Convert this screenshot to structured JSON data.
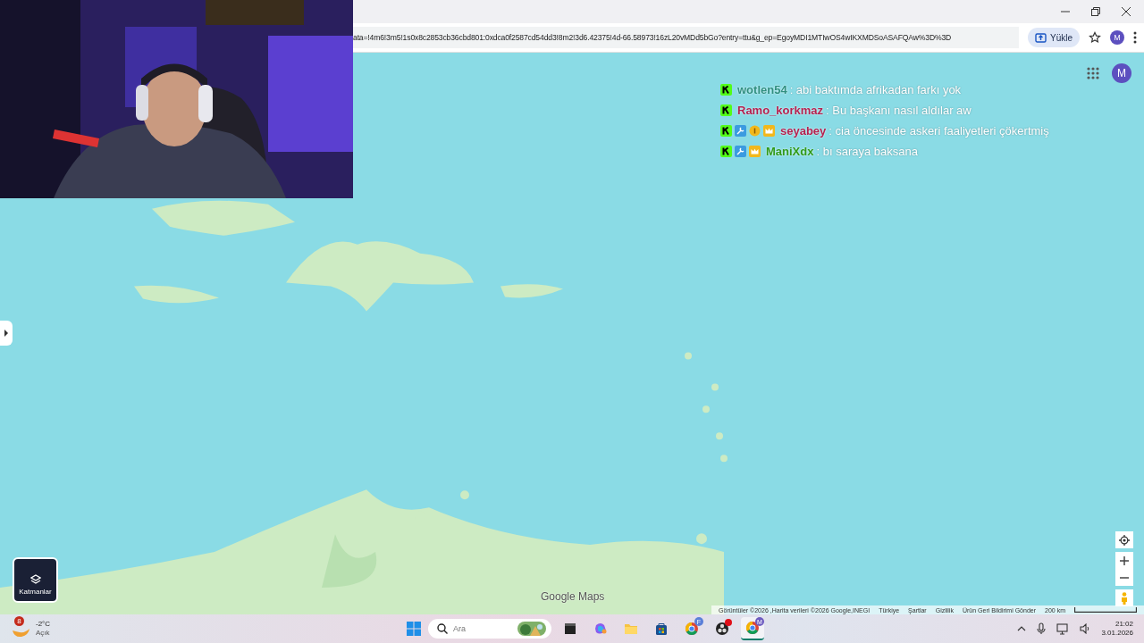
{
  "browser": {
    "address": "ata=!4m6!3m5!1s0x8c2853cb36cbd801:0xdca0f2587cd54dd3!8m2!3d6.42375!4d-66.58973!16zL20vMDd5bGo?entry=ttu&g_ep=EgoyMDI1MTIwOS4wIKXMDSoASAFQAw%3D%3D",
    "upload_button": "Yükle",
    "profile": "M"
  },
  "map": {
    "kind": "picture",
    "account": "M",
    "layers_button": "Katmanlar",
    "logo": "Google Maps",
    "footer": [
      "Görüntüler ©2026 ,Harita verileri ©2026 Google,INEGI",
      "Türkiye",
      "Şartlar",
      "Gizlilik",
      "Ürün Geri Bildirimi Gönder"
    ],
    "scale": "200 km"
  },
  "chat": [
    {
      "user": "wotlen54",
      "color": "#2f8f80",
      "badges": [
        {
          "kind": "kick"
        }
      ],
      "message": ": abi baktımda afrikadan farkı yok"
    },
    {
      "user": "Ramo_korkmaz",
      "color": "#b3214f",
      "badges": [
        {
          "kind": "kick"
        }
      ],
      "message": ": Bu başkanı nasıl aldılar aw"
    },
    {
      "user": "seyabey",
      "color": "#b3214f",
      "badges": [
        {
          "kind": "kick"
        },
        {
          "kind": "wrench"
        },
        {
          "kind": "coin"
        },
        {
          "kind": "crown"
        }
      ],
      "message": ": cia öncesinde askeri faaliyetleri çökertmiş"
    },
    {
      "user": "ManiXdx",
      "color": "#2f9a1a",
      "badges": [
        {
          "kind": "kick"
        },
        {
          "kind": "wrench"
        },
        {
          "kind": "crown"
        }
      ],
      "message": ": bı saraya baksana"
    }
  ],
  "taskbar": {
    "weather": {
      "badge": "8",
      "temperature": "-2°C",
      "condition": "Açık"
    },
    "search": {
      "placeholder": "Ara"
    },
    "apps": [
      {
        "kind": "terminal",
        "selected": false
      },
      {
        "kind": "copilot",
        "selected": false
      },
      {
        "kind": "folder",
        "selected": false
      },
      {
        "kind": "store",
        "selected": false
      },
      {
        "kind": "chrome",
        "badge": "F",
        "selected": false
      },
      {
        "kind": "obs",
        "selected": false
      },
      {
        "kind": "chrome",
        "badge": "M",
        "selected": true
      }
    ],
    "time": "21:02",
    "date": "3.01.2026"
  }
}
